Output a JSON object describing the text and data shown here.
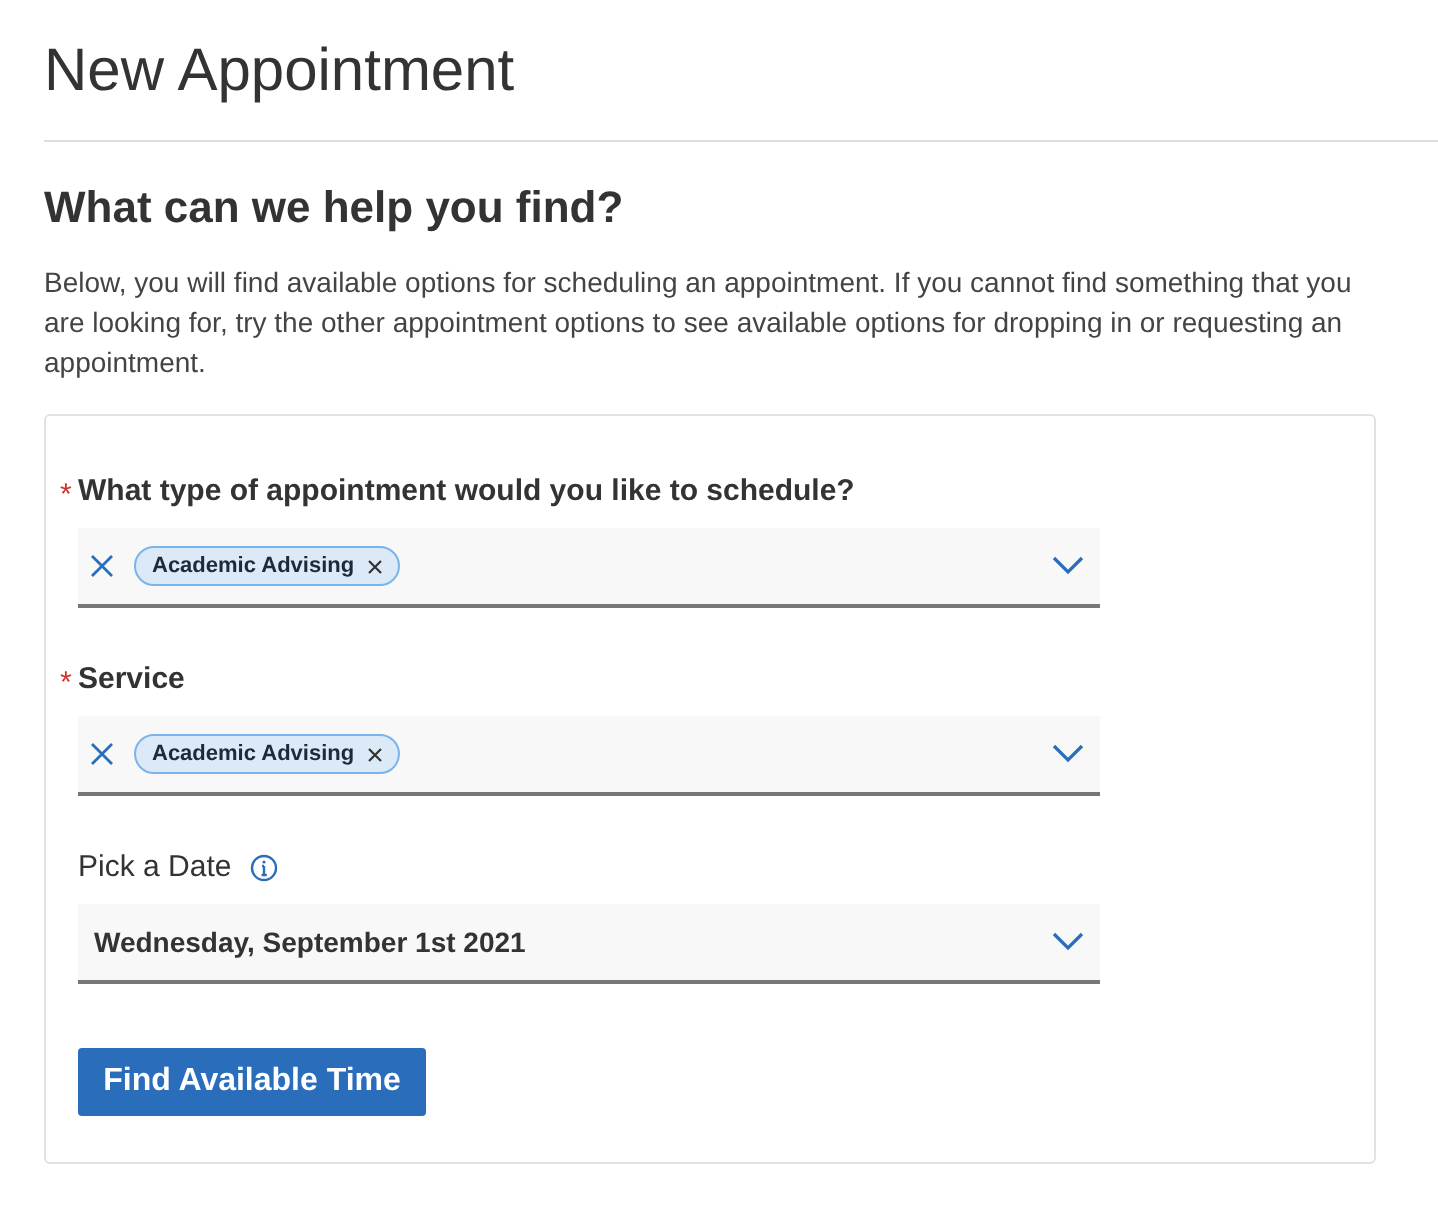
{
  "page_title": "New Appointment",
  "heading": "What can we help you find?",
  "intro": "Below, you will find available options for scheduling an appointment. If you cannot find something that you are looking for, try the other appointment options to see available options for dropping in or requesting an appointment.",
  "fields": [
    {
      "kind": "multiselect",
      "label": "What type of appointment would you like to schedule?",
      "required": true,
      "required_mark": "*",
      "tags": [
        "Academic Advising"
      ]
    },
    {
      "kind": "multiselect",
      "label": "Service",
      "required": true,
      "required_mark": "*",
      "tags": [
        "Academic Advising"
      ]
    },
    {
      "kind": "date",
      "label": "Pick a Date",
      "required": false,
      "info": true,
      "value": "Wednesday, September 1st 2021"
    }
  ],
  "submit_button": "Find Available Time"
}
